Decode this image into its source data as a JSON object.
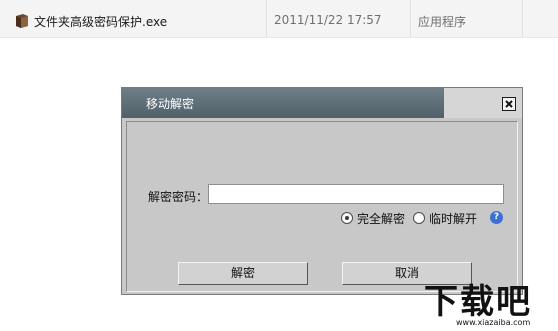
{
  "file": {
    "name": "文件夹高级密码保护.exe",
    "date": "2011/11/22 17:57",
    "type": "应用程序"
  },
  "dialog": {
    "title": "移动解密",
    "password_label": "解密密码：",
    "password_value": "",
    "options": [
      {
        "label": "完全解密",
        "selected": true
      },
      {
        "label": "临时解开",
        "selected": false
      }
    ],
    "decrypt_button": "解密",
    "cancel_button": "取消"
  },
  "watermark": {
    "text": "下载吧",
    "url": "www.xiazaiba.com"
  },
  "colors": {
    "title_bar": "#5f6f78",
    "dialog_bg": "#c8c8c8",
    "help_icon": "#3d6fd8"
  },
  "icons": [
    "exe-file-icon",
    "close-icon",
    "help-icon"
  ]
}
